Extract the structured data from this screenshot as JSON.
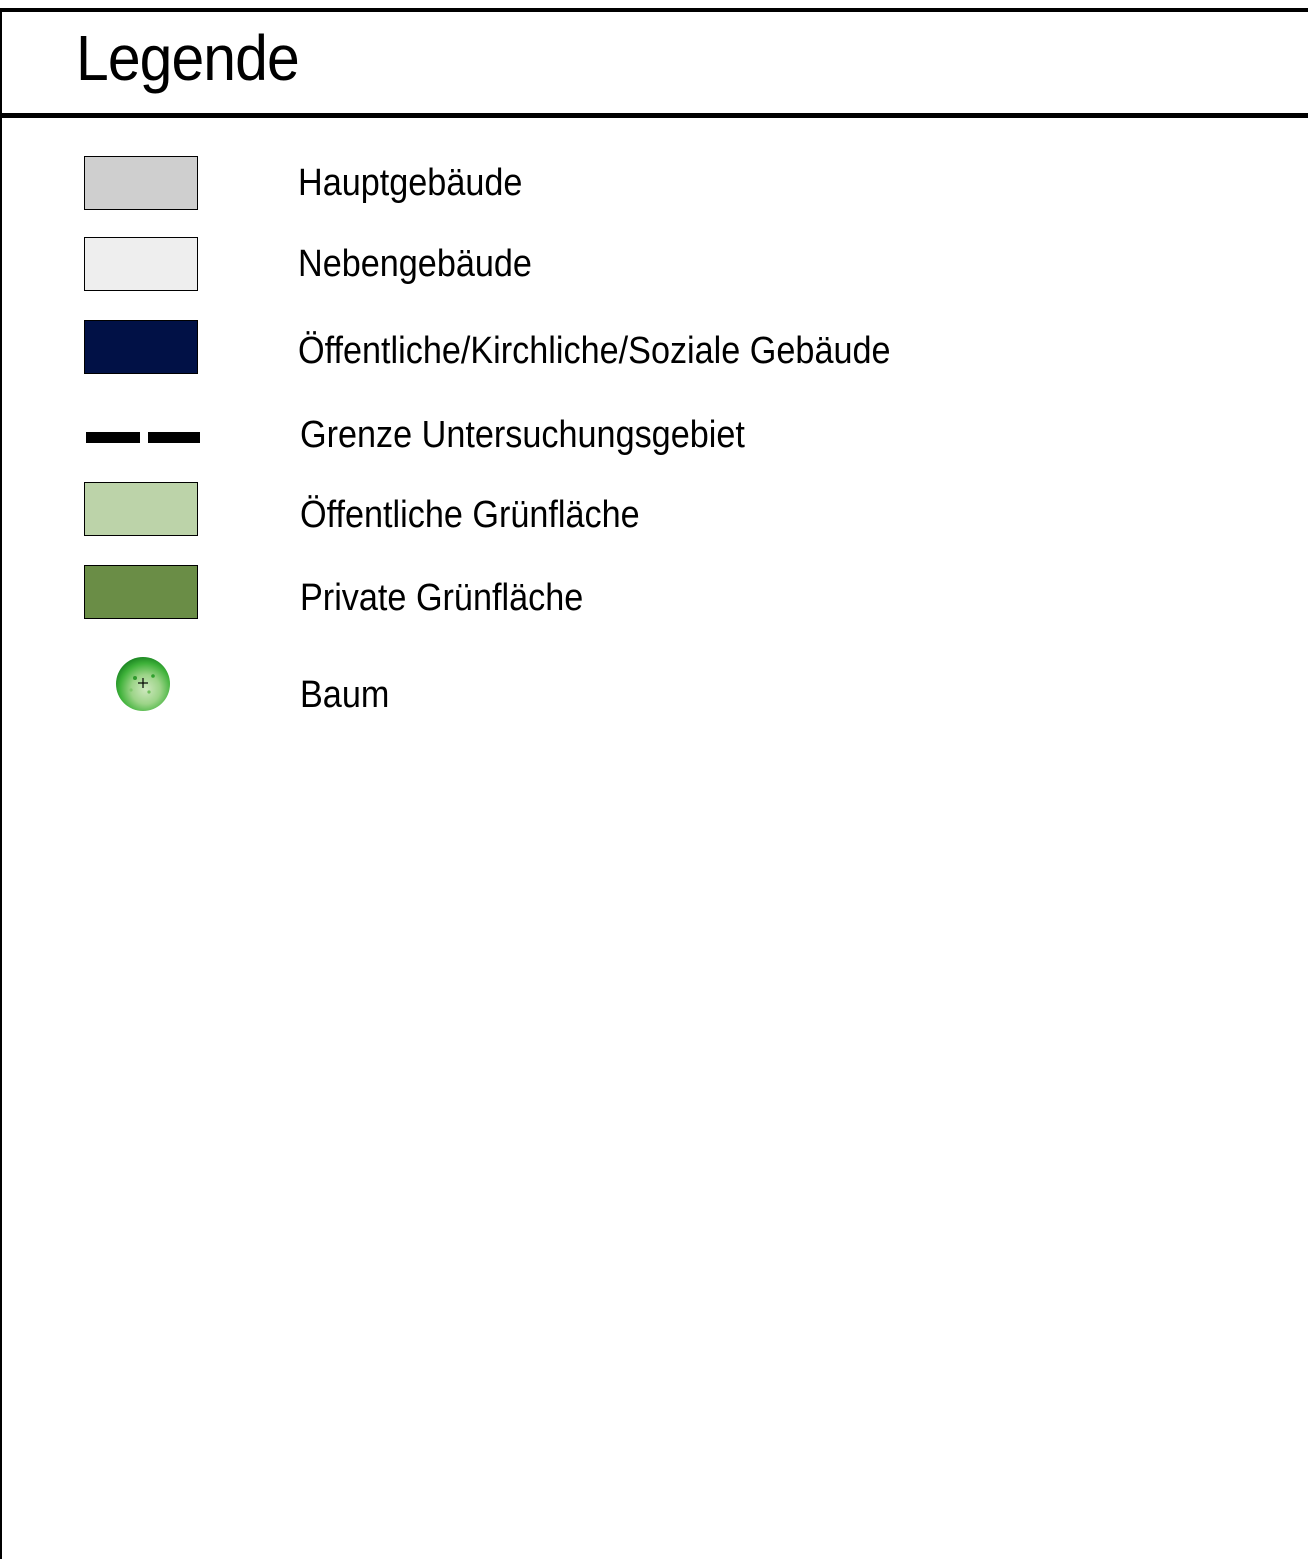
{
  "legend": {
    "title": "Legende",
    "items": [
      {
        "label": "Hauptgebäude",
        "symbol": "filled-rectangle",
        "color": "#cfcfcf"
      },
      {
        "label": "Nebengebäude",
        "symbol": "filled-rectangle",
        "color": "#eeeeee"
      },
      {
        "label": "Öffentliche/Kirchliche/Soziale Gebäude",
        "symbol": "filled-rectangle",
        "color": "#011146"
      },
      {
        "label": "Grenze Untersuchungsgebiet",
        "symbol": "dashed-line",
        "color": "#000000"
      },
      {
        "label": "Öffentliche Grünfläche",
        "symbol": "filled-rectangle",
        "color": "#bcd3a9"
      },
      {
        "label": "Private Grünfläche",
        "symbol": "filled-rectangle",
        "color": "#6a8d46"
      },
      {
        "label": "Baum",
        "symbol": "tree-icon",
        "color": "#3aa535"
      }
    ]
  }
}
